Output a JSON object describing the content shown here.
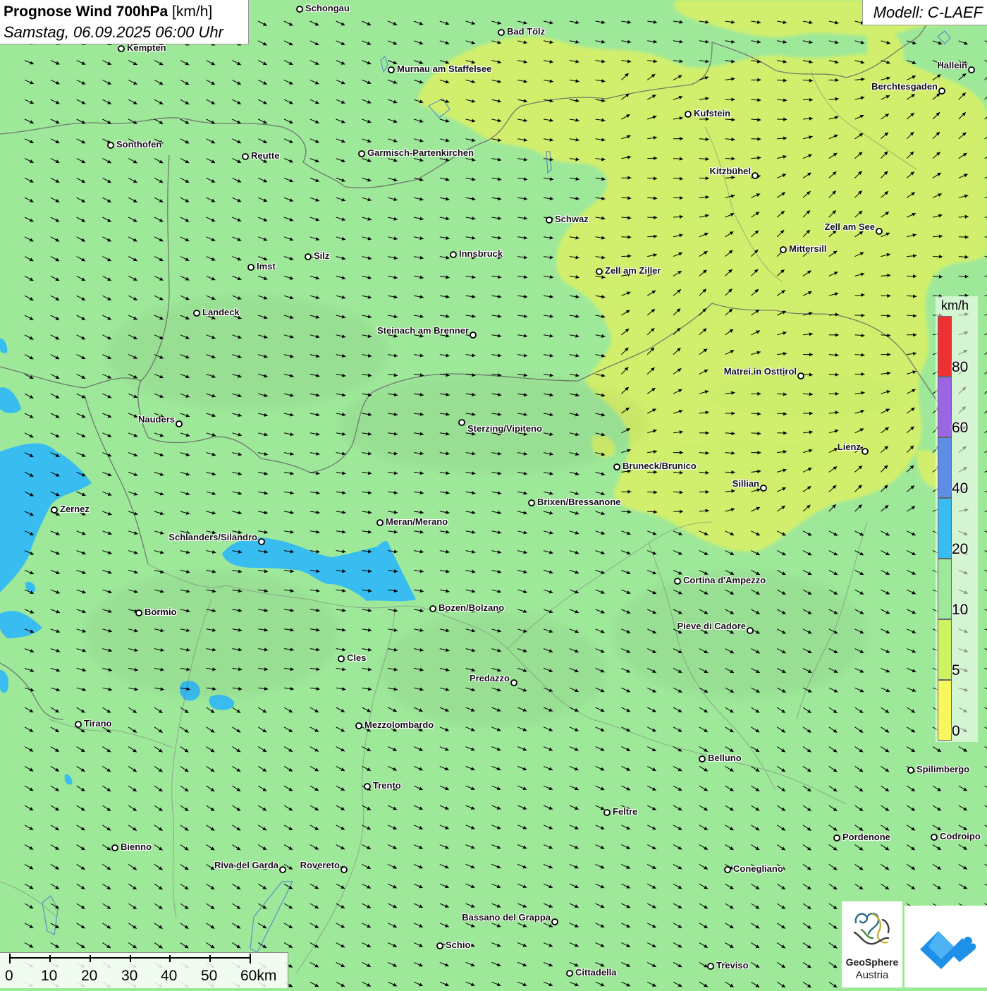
{
  "header": {
    "title_bold": "Prognose Wind 700hPa",
    "title_unit": "[km/h]",
    "datetime": "Samstag, 06.09.2025 06:00 Uhr",
    "model": "Modell: C-LAEF"
  },
  "legend": {
    "unit": "km/h",
    "bins": [
      {
        "label": "0",
        "color": "#f7f75e"
      },
      {
        "label": "5",
        "color": "#cdf262"
      },
      {
        "label": "10",
        "color": "#9ee89a"
      },
      {
        "label": "20",
        "color": "#39bdf0"
      },
      {
        "label": "40",
        "color": "#5d8de6"
      },
      {
        "label": "60",
        "color": "#9a66e3"
      },
      {
        "label": "80",
        "color": "#ee3030"
      }
    ]
  },
  "scale_bar": {
    "labels": [
      "0",
      "10",
      "20",
      "30",
      "40",
      "50",
      "60km"
    ]
  },
  "cities": [
    {
      "name": "Schongau"
    },
    {
      "name": "Bad Tölz"
    },
    {
      "name": "Kempten"
    },
    {
      "name": "Murnau am Staffelsee"
    },
    {
      "name": "Hallein"
    },
    {
      "name": "Berchtesgaden"
    },
    {
      "name": "Kufstein"
    },
    {
      "name": "Sonthofen"
    },
    {
      "name": "Reutte"
    },
    {
      "name": "Garmisch-Partenkirchen"
    },
    {
      "name": "Kitzbühel"
    },
    {
      "name": "Schwaz"
    },
    {
      "name": "Zell am See"
    },
    {
      "name": "Mittersill"
    },
    {
      "name": "Innsbruck"
    },
    {
      "name": "Silz"
    },
    {
      "name": "Imst"
    },
    {
      "name": "Zell am Ziller"
    },
    {
      "name": "Landeck"
    },
    {
      "name": "Steinach am Brenner"
    },
    {
      "name": "Matrei in Osttirol"
    },
    {
      "name": "Nauders"
    },
    {
      "name": "Sterzing/Vipiteno"
    },
    {
      "name": "Lienz"
    },
    {
      "name": "Bruneck/Brunico"
    },
    {
      "name": "Sillian"
    },
    {
      "name": "Zernez"
    },
    {
      "name": "Brixen/Bressanone"
    },
    {
      "name": "Meran/Merano"
    },
    {
      "name": "Schlanders/Silandro"
    },
    {
      "name": "Cortina d'Ampezzo"
    },
    {
      "name": "Bozen/Bolzano"
    },
    {
      "name": "Bormio"
    },
    {
      "name": "Pieve di Cadore"
    },
    {
      "name": "Cles"
    },
    {
      "name": "Predazzo"
    },
    {
      "name": "Tirano"
    },
    {
      "name": "Mezzolombardo"
    },
    {
      "name": "Belluno"
    },
    {
      "name": "Spilimbergo"
    },
    {
      "name": "Trento"
    },
    {
      "name": "Feltre"
    },
    {
      "name": "Bienno"
    },
    {
      "name": "Pordenone"
    },
    {
      "name": "Codroipo"
    },
    {
      "name": "Riva del Garda"
    },
    {
      "name": "Rovereto"
    },
    {
      "name": "Conegliano"
    },
    {
      "name": "Bassano del Grappa"
    },
    {
      "name": "Schio"
    },
    {
      "name": "Treviso"
    },
    {
      "name": "Cittadella"
    }
  ],
  "logos": {
    "geosphere_line1": "GeoSphere",
    "geosphere_line2": "Austria"
  }
}
